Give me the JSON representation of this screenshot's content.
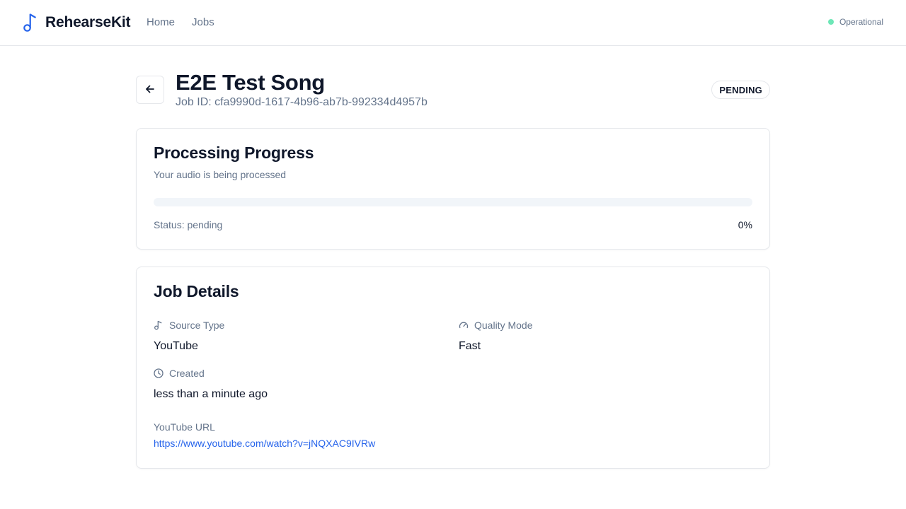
{
  "header": {
    "brand": "RehearseKit",
    "nav": [
      "Home",
      "Jobs"
    ],
    "status": "Operational",
    "status_color": "#6ee7b7",
    "brand_icon": "music-note-icon"
  },
  "page": {
    "title": "E2E Test Song",
    "job_id": "Job ID: cfa9990d-1617-4b96-ab7b-992334d4957b",
    "badge": "PENDING",
    "back_icon": "arrow-left-icon"
  },
  "progress": {
    "title": "Processing Progress",
    "description": "Your audio is being processed",
    "status_text": "Status: pending",
    "percent_text": "0%",
    "percent": 0
  },
  "details": {
    "title": "Job Details",
    "source_type_label": "Source Type",
    "source_type_value": "YouTube",
    "quality_mode_label": "Quality Mode",
    "quality_mode_value": "Fast",
    "created_label": "Created",
    "created_value": "less than a minute ago",
    "youtube_url_label": "YouTube URL",
    "youtube_url": "https://www.youtube.com/watch?v=jNQXAC9IVRw"
  },
  "colors": {
    "accent": "#2563eb",
    "text": "#0f172a",
    "muted": "#64748b",
    "border": "#e5e7eb"
  }
}
